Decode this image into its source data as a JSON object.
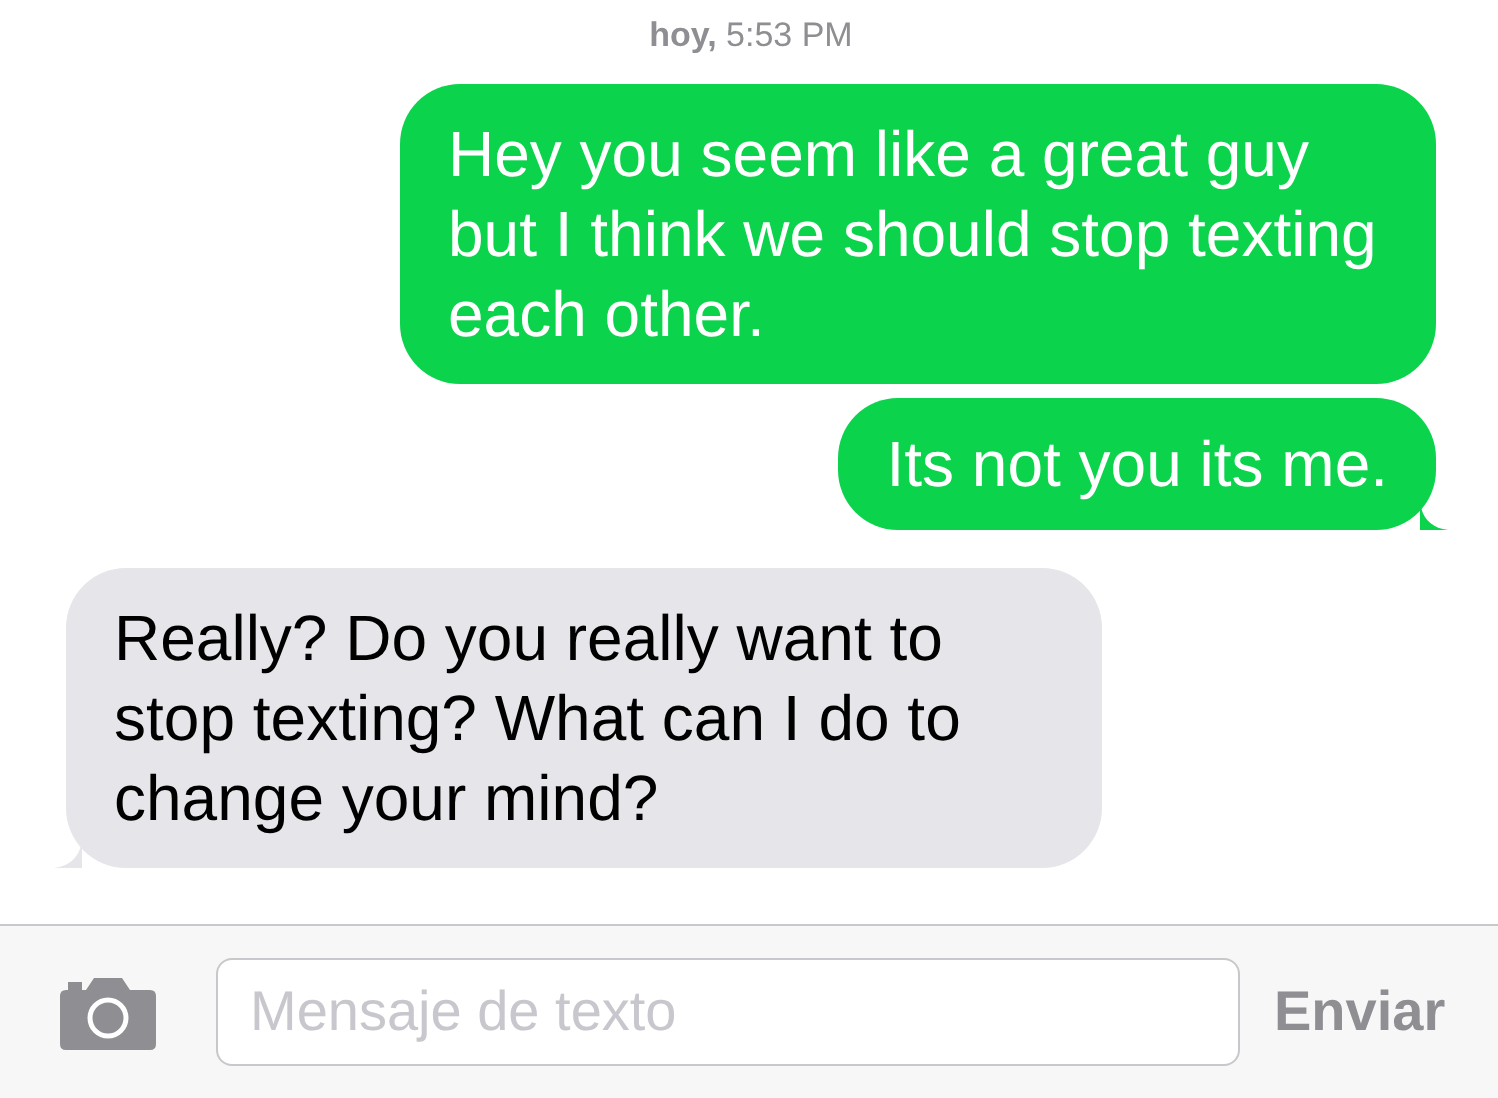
{
  "timestamp": "**hoy,** 5:53 PM",
  "messages": [
    {
      "kind": "sent",
      "text": "Hey you seem like a great guy but I think we should stop texting each other.",
      "tail": false
    },
    {
      "kind": "sent",
      "text": "Its not you its me.",
      "tail": true
    },
    {
      "kind": "received",
      "text": "Really? Do you really want to stop texting? What can I do to change your mind?",
      "tail": true
    }
  ],
  "composer": {
    "placeholder": "Mensaje de texto",
    "send": "Enviar"
  }
}
